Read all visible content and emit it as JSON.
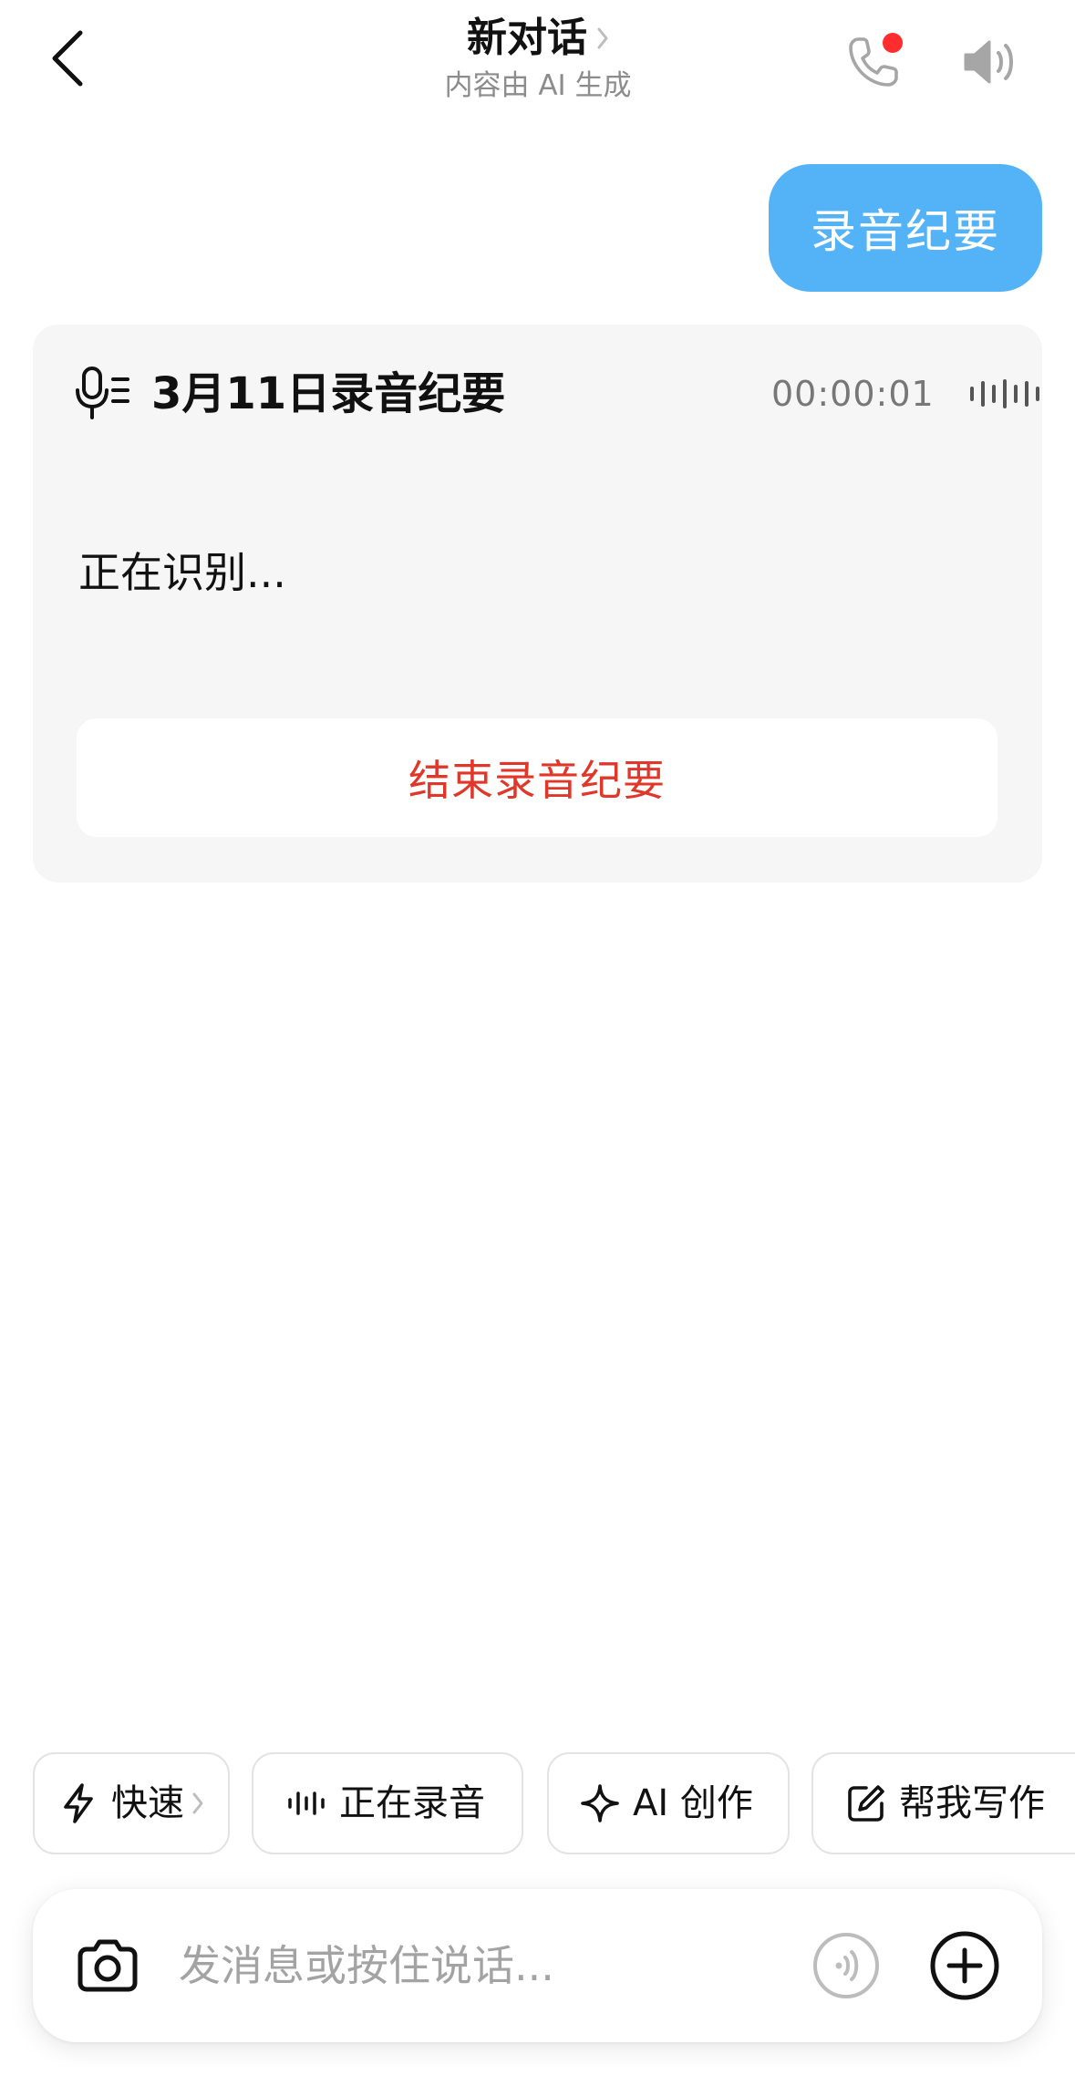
{
  "header": {
    "back_icon": "chevron-left-icon",
    "title": "新对话",
    "title_chevron_icon": "chevron-right-icon",
    "subtitle": "内容由 AI 生成",
    "phone_icon": "phone-icon",
    "phone_dot_color": "#ff2d2d",
    "speaker_icon": "speaker-icon"
  },
  "chat": {
    "user_message": "录音纪要",
    "user_bubble_color": "#54b3f7"
  },
  "recording_card": {
    "mic_icon": "mic-list-icon",
    "title": "3月11日录音纪要",
    "duration": "00:00:01",
    "waveform_icon": "waveform-icon",
    "status": "正在识别...",
    "end_button_label": "结束录音纪要",
    "end_button_color": "#e0372b"
  },
  "quick_actions": [
    {
      "label": "快速",
      "icon": "lightning-icon",
      "has_chevron": true
    },
    {
      "label": "正在录音",
      "icon": "waveform-icon"
    },
    {
      "label": "AI 创作",
      "icon": "sparkle-icon"
    },
    {
      "label": "帮我写作",
      "icon": "edit-icon"
    }
  ],
  "input_bar": {
    "camera_icon": "camera-icon",
    "placeholder": "发消息或按住说话...",
    "value": "",
    "voice_icon": "voice-wave-icon",
    "plus_icon": "plus-circle-icon"
  }
}
